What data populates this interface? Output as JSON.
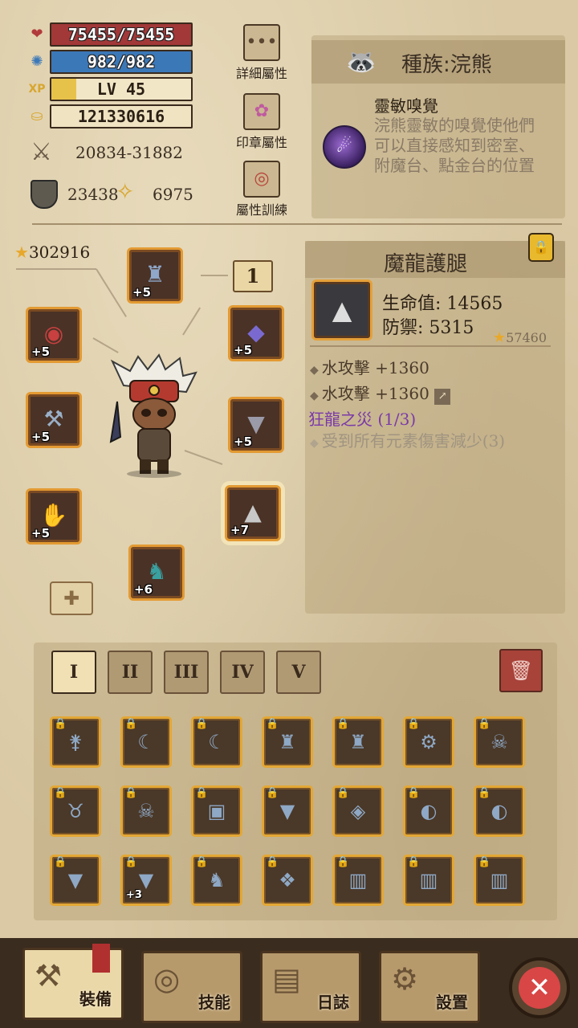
{
  "stats": {
    "hp": "75455/75455",
    "mp": "982/982",
    "level": "LV 45",
    "level_progress": 0.18,
    "gold": "121330616",
    "attack": "20834-31882",
    "defense": "23438",
    "luck": "6975"
  },
  "menu": {
    "details_label": "詳細屬性",
    "seal_label": "印章屬性",
    "training_label": "屬性訓練"
  },
  "race": {
    "title": "種族:浣熊",
    "trait_name": "靈敏嗅覺",
    "trait_desc": "浣熊靈敏的嗅覺使他們可以直接感知到密室、附魔台、點金台的位置"
  },
  "equipment": {
    "score": "302916",
    "loadout": "1",
    "slots": [
      {
        "name": "helmet",
        "level": "+5",
        "icon": "dragon-helm"
      },
      {
        "name": "amulet",
        "level": "+5",
        "icon": "eye-amulet"
      },
      {
        "name": "gems",
        "level": "+5",
        "icon": "gem-cluster"
      },
      {
        "name": "weapon",
        "level": "+5",
        "icon": "battle-axe"
      },
      {
        "name": "armor",
        "level": "+5",
        "icon": "dark-armor"
      },
      {
        "name": "gloves",
        "level": "+5",
        "icon": "gauntlet"
      },
      {
        "name": "leggings",
        "level": "+7",
        "icon": "dragon-leggings"
      },
      {
        "name": "boots",
        "level": "+6",
        "icon": "dragon-boots"
      }
    ]
  },
  "item_detail": {
    "name": "魔龍護腿",
    "hp": "生命值: 14565",
    "defense": "防禦: 5315",
    "score": "57460",
    "mod1": "水攻擊 +1360",
    "mod2": "水攻擊 +1360",
    "set_name": "狂龍之災 (1/3)",
    "set_effect": "受到所有元素傷害減少(3)"
  },
  "inventory": {
    "tabs": [
      "I",
      "II",
      "III",
      "IV",
      "V"
    ],
    "active_tab": 0,
    "items": [
      {
        "icon": "bone-club",
        "locked": true,
        "level": ""
      },
      {
        "icon": "curved-dagger",
        "locked": true,
        "level": ""
      },
      {
        "icon": "curved-dagger",
        "locked": true,
        "level": ""
      },
      {
        "icon": "dragon-helm",
        "locked": true,
        "level": ""
      },
      {
        "icon": "dragon-helm",
        "locked": true,
        "level": ""
      },
      {
        "icon": "broken-gear",
        "locked": true,
        "level": ""
      },
      {
        "icon": "skull-mask",
        "locked": true,
        "level": ""
      },
      {
        "icon": "horned-mask",
        "locked": true,
        "level": ""
      },
      {
        "icon": "skull-mask",
        "locked": true,
        "level": ""
      },
      {
        "icon": "bone-armor",
        "locked": true,
        "level": ""
      },
      {
        "icon": "fang-armor",
        "locked": true,
        "level": ""
      },
      {
        "icon": "shell-armor",
        "locked": true,
        "level": ""
      },
      {
        "icon": "teal-gloves",
        "locked": true,
        "level": ""
      },
      {
        "icon": "teal-gloves",
        "locked": true,
        "level": ""
      },
      {
        "icon": "dark-armor",
        "locked": true,
        "level": ""
      },
      {
        "icon": "dark-armor",
        "locked": true,
        "level": "+3"
      },
      {
        "icon": "dragon-boots",
        "locked": true,
        "level": ""
      },
      {
        "icon": "crystal-armor",
        "locked": true,
        "level": ""
      },
      {
        "icon": "red-boots",
        "locked": true,
        "level": ""
      },
      {
        "icon": "red-boots",
        "locked": true,
        "level": ""
      },
      {
        "icon": "red-boots",
        "locked": true,
        "level": ""
      }
    ]
  },
  "nav": {
    "equip": "裝備",
    "skills": "技能",
    "journal": "日誌",
    "settings": "設置"
  },
  "colors": {
    "hp_bar": "#a23838",
    "mp_bar": "#3b78b8",
    "slot_border": "#e39a32",
    "set_name": "#7a3aa8",
    "close_button": "#d84646"
  }
}
